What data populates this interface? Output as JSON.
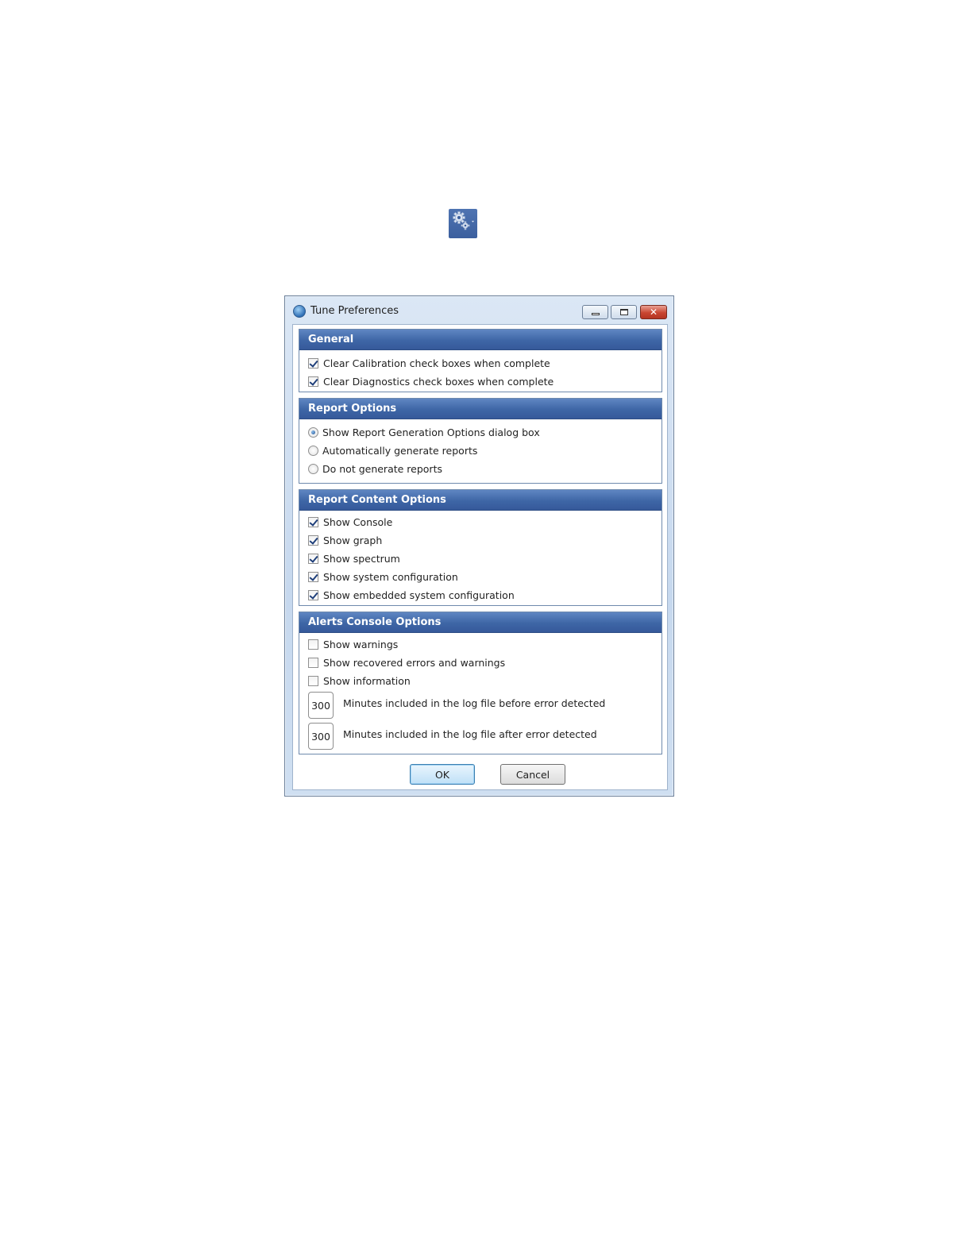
{
  "toolbar_icon": {
    "icon": "gears-dropdown-icon",
    "tile_color": "#3b5f9e"
  },
  "window": {
    "title": "Tune Preferences",
    "icon": "app-logo-icon",
    "controls": {
      "minimize": "minimize-icon",
      "maximize": "maximize-icon",
      "close": "close-icon"
    }
  },
  "general": {
    "title": "General",
    "items": [
      {
        "label": "Clear Calibration check boxes when complete",
        "checked": true
      },
      {
        "label": "Clear Diagnostics check boxes when complete",
        "checked": true
      }
    ]
  },
  "report_options": {
    "title": "Report Options",
    "items": [
      {
        "label": "Show Report Generation Options dialog box",
        "selected": true
      },
      {
        "label": "Automatically generate reports",
        "selected": false
      },
      {
        "label": "Do not generate reports",
        "selected": false
      }
    ]
  },
  "report_content": {
    "title": "Report Content Options",
    "items": [
      {
        "label": "Show Console",
        "checked": true
      },
      {
        "label": "Show graph",
        "checked": true
      },
      {
        "label": "Show spectrum",
        "checked": true
      },
      {
        "label": "Show system configuration",
        "checked": true
      },
      {
        "label": "Show embedded system configuration",
        "checked": true
      }
    ]
  },
  "alerts_console": {
    "title": "Alerts Console Options",
    "items": [
      {
        "label": "Show warnings",
        "checked": false
      },
      {
        "label": "Show recovered errors and warnings",
        "checked": false
      },
      {
        "label": "Show information",
        "checked": false
      }
    ],
    "minutes_before": {
      "value": "300",
      "label": "Minutes included in the log file before error detected"
    },
    "minutes_after": {
      "value": "300",
      "label": "Minutes included in the log file after error detected"
    }
  },
  "buttons": {
    "ok": "OK",
    "cancel": "Cancel"
  },
  "colors": {
    "group_header": "#3e66a6",
    "accent": "#1f3f7a"
  }
}
